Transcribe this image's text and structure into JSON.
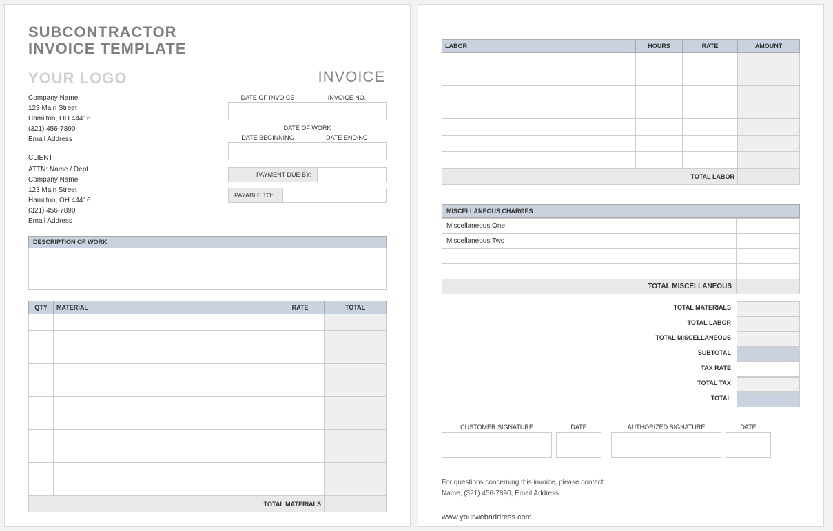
{
  "header": {
    "title_line1": "SUBCONTRACTOR",
    "title_line2": "INVOICE TEMPLATE",
    "logo_placeholder": "YOUR LOGO",
    "invoice_word": "INVOICE"
  },
  "company": {
    "name": "Company Name",
    "street": "123 Main Street",
    "city_line": "Hamilton, OH  44416",
    "phone": "(321) 456-7890",
    "email": "Email Address"
  },
  "client": {
    "heading": "CLIENT",
    "attn": "ATTN: Name / Dept",
    "name": "Company Name",
    "street": "123 Main Street",
    "city_line": "Hamilton, OH  44416",
    "phone": "(321) 456-7890",
    "email": "Email Address"
  },
  "meta": {
    "date_of_invoice_label": "DATE OF INVOICE",
    "invoice_no_label": "INVOICE NO.",
    "date_of_work_label": "DATE OF WORK",
    "date_beginning_label": "DATE BEGINNING",
    "date_ending_label": "DATE ENDING",
    "payment_due_label": "PAYMENT DUE BY:",
    "payable_to_label": "PAYABLE TO:"
  },
  "description": {
    "heading": "DESCRIPTION OF WORK"
  },
  "materials": {
    "cols": {
      "qty": "QTY",
      "material": "MATERIAL",
      "rate": "RATE",
      "total": "TOTAL"
    },
    "total_label": "TOTAL MATERIALS"
  },
  "labor": {
    "cols": {
      "labor": "LABOR",
      "hours": "HOURS",
      "rate": "RATE",
      "amount": "AMOUNT"
    },
    "total_label": "TOTAL LABOR"
  },
  "misc": {
    "heading": "MISCELLANEOUS CHARGES",
    "row1": "Miscellaneous One",
    "row2": "Miscellaneous Two",
    "total_label": "TOTAL MISCELLANEOUS"
  },
  "summary": {
    "total_materials": "TOTAL MATERIALS",
    "total_labor": "TOTAL LABOR",
    "total_misc": "TOTAL MISCELLANEOUS",
    "subtotal": "SUBTOTAL",
    "tax_rate": "TAX RATE",
    "total_tax": "TOTAL TAX",
    "total": "TOTAL"
  },
  "signatures": {
    "customer": "CUSTOMER SIGNATURE",
    "date": "DATE",
    "authorized": "AUTHORIZED SIGNATURE"
  },
  "contact": {
    "line1": "For questions concerning this invoice, please contact:",
    "line2": "Name, (321) 456-7890, Email Address",
    "web": "www.yourwebaddress.com"
  }
}
